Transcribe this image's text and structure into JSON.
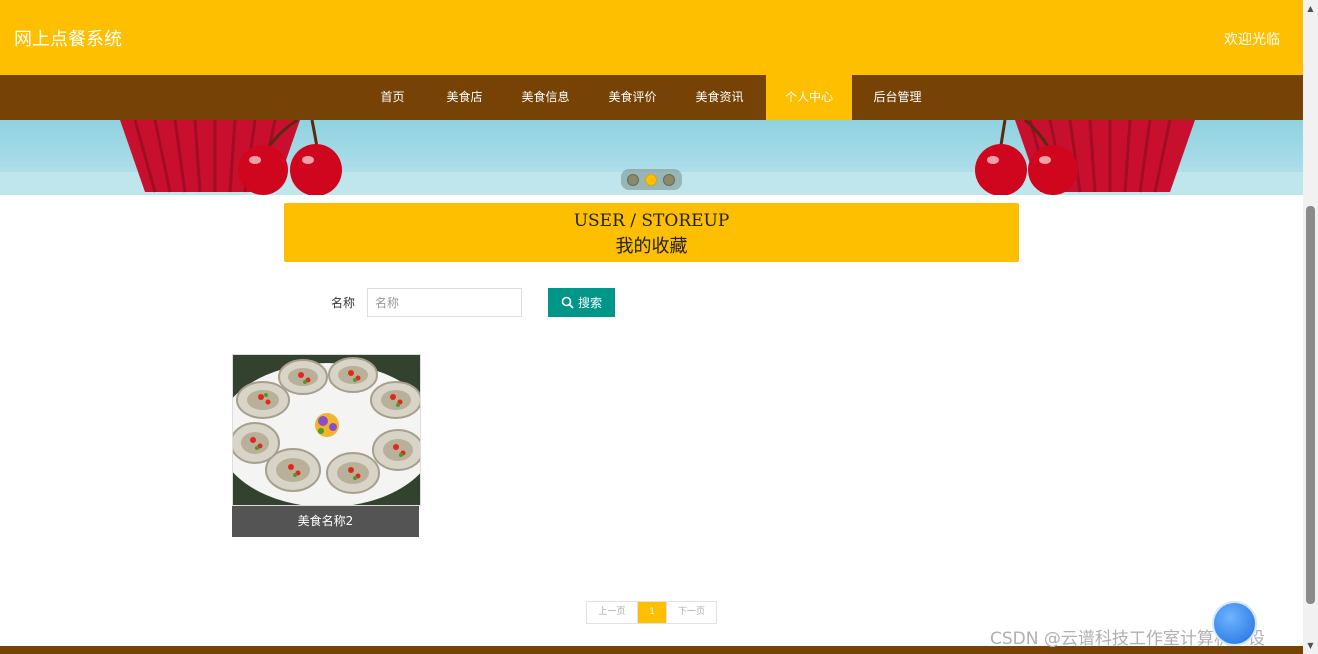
{
  "header": {
    "site_title": "网上点餐系统",
    "welcome": "欢迎光临"
  },
  "nav": {
    "items": [
      {
        "label": "首页"
      },
      {
        "label": "美食店"
      },
      {
        "label": "美食信息"
      },
      {
        "label": "美食评价"
      },
      {
        "label": "美食资讯"
      },
      {
        "label": "个人中心",
        "active": true
      },
      {
        "label": "后台管理"
      }
    ]
  },
  "carousel": {
    "slide_count": 3,
    "active_index": 1
  },
  "section": {
    "title_en": "USER / STOREUP",
    "title_cn": "我的收藏"
  },
  "search": {
    "label": "名称",
    "placeholder": "名称",
    "button_label": "搜索"
  },
  "favorites": [
    {
      "name": "美食名称2",
      "image": "oysters-plate-photo"
    }
  ],
  "pagination": {
    "prev_label": "上一页",
    "current_page": "1",
    "next_label": "下一页"
  },
  "watermark": "CSDN @云谱科技工作室计算机毕设",
  "colors": {
    "primary": "#FDBF00",
    "nav_bg": "#764205",
    "search_button": "#009688",
    "caption_bg": "#545454"
  }
}
